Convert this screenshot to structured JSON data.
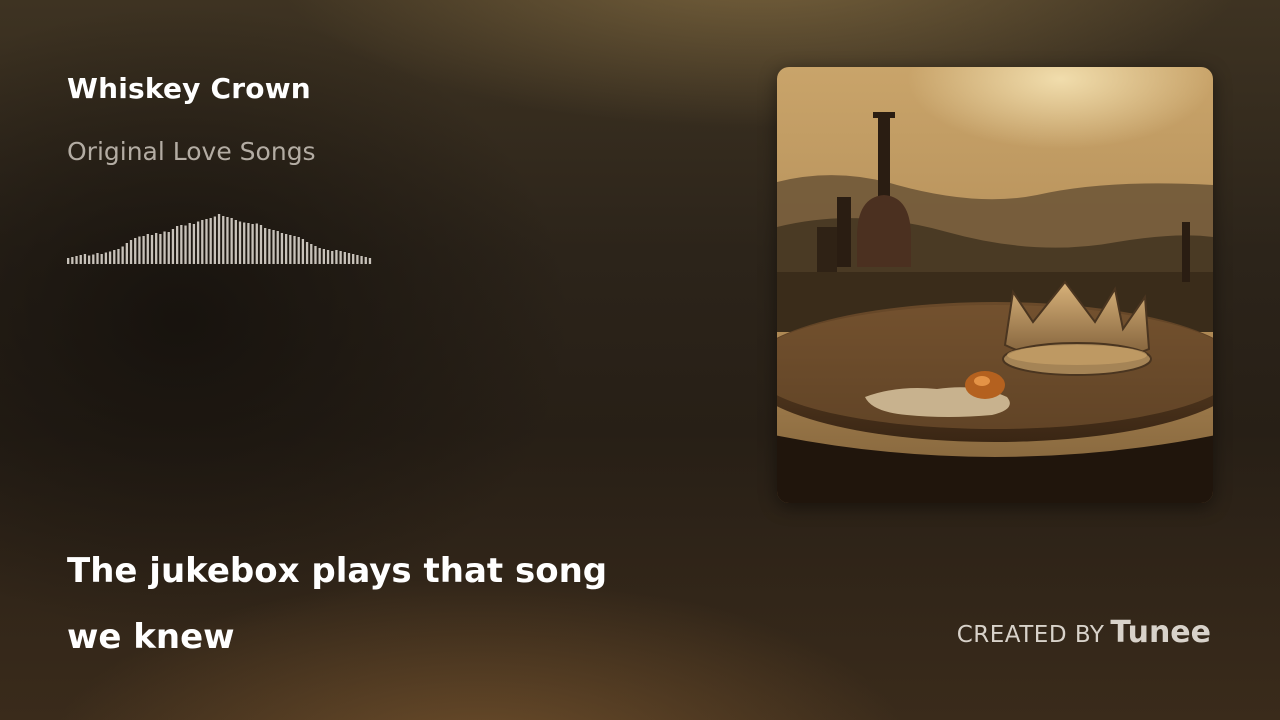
{
  "track": {
    "title": "Whiskey Crown",
    "subtitle": "Original Love Songs"
  },
  "waveform": {
    "bar_heights": [
      0.12,
      0.14,
      0.16,
      0.18,
      0.2,
      0.17,
      0.19,
      0.22,
      0.2,
      0.23,
      0.25,
      0.28,
      0.3,
      0.35,
      0.42,
      0.48,
      0.52,
      0.55,
      0.56,
      0.6,
      0.58,
      0.62,
      0.6,
      0.65,
      0.64,
      0.7,
      0.76,
      0.78,
      0.77,
      0.82,
      0.8,
      0.85,
      0.88,
      0.9,
      0.92,
      0.95,
      1.0,
      0.96,
      0.94,
      0.92,
      0.88,
      0.85,
      0.83,
      0.82,
      0.8,
      0.81,
      0.78,
      0.72,
      0.7,
      0.68,
      0.66,
      0.62,
      0.6,
      0.58,
      0.56,
      0.54,
      0.5,
      0.44,
      0.4,
      0.36,
      0.32,
      0.3,
      0.28,
      0.26,
      0.28,
      0.26,
      0.24,
      0.22,
      0.2,
      0.18,
      0.16,
      0.14,
      0.12
    ]
  },
  "lyrics": {
    "line1": "The jukebox plays that song",
    "line2": "we knew"
  },
  "album_art": {
    "icon": "album-cover-crown-on-barrel"
  },
  "credit": {
    "prefix": "CREATED BY",
    "brand": "Tunee"
  },
  "colors": {
    "title": "#ffffff",
    "subtitle": "#b3aca3",
    "waveform": "#c8c2ba",
    "credit": "#d8d2ca"
  }
}
